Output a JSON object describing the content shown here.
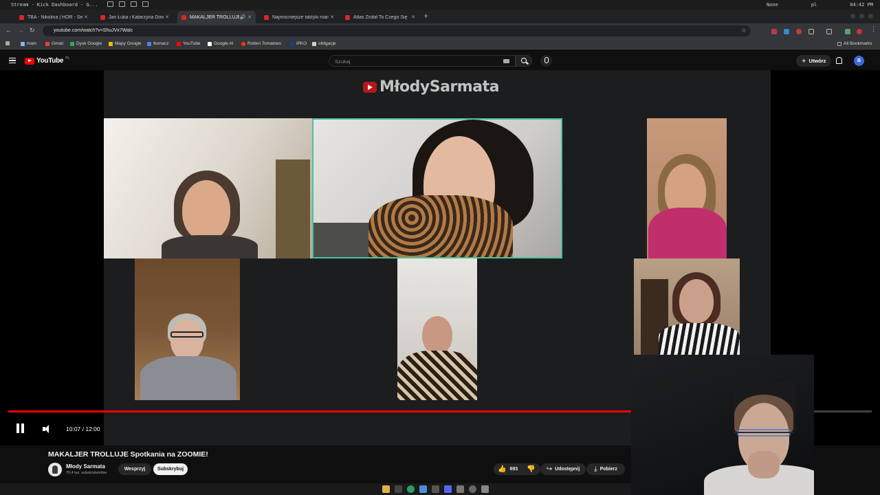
{
  "os_bar": {
    "title": "Stream - Kick Dashboard - G...",
    "status_none": "None",
    "lang": "pl",
    "clock": "04:42 PM"
  },
  "tabs": [
    {
      "label": "TBA - Nikolina | HÖR - Septe",
      "active": false
    },
    {
      "label": "Jan Łuka i Katarzyna Dowb",
      "active": false
    },
    {
      "label": "MAKALJER TROLLUJE S",
      "active": true
    },
    {
      "label": "Najmocniejsze taktyki manip",
      "active": false
    },
    {
      "label": "Atlas Zrobił To Czego Się",
      "active": false
    }
  ],
  "address": {
    "url": "youtube.com/watch?v=ShuJVx7Walc"
  },
  "bookmarks": [
    {
      "label": "main",
      "color": "#8ab4f8"
    },
    {
      "label": "Gmail",
      "color": "#ea4335"
    },
    {
      "label": "Dysk Google",
      "color": "#34a853"
    },
    {
      "label": "Mapy Google",
      "color": "#fbbc04"
    },
    {
      "label": "tłumacz",
      "color": "#4285f4"
    },
    {
      "label": "YouTube",
      "color": "#ff0000"
    },
    {
      "label": "Google AI",
      "color": "#ffffff"
    },
    {
      "label": "Rotten Tomatoes",
      "color": "#fa320a"
    },
    {
      "label": "iPKO",
      "color": "#1e3a8a"
    },
    {
      "label": "obligacje",
      "color": "#cfcfcf"
    }
  ],
  "all_bookmarks": "All Bookmarks",
  "yt": {
    "logo": "YouTube",
    "country": "PL",
    "search_placeholder": "Szukaj",
    "create_label": "Utwórz",
    "avatar_letter": "B"
  },
  "video": {
    "channel_watermark": "MłodySarmata",
    "progress": 0.8389,
    "time": "10:07 / 12:00"
  },
  "meta": {
    "title": "MAKALJER TROLLUJE Spotkania na ZOOMIE!",
    "channel": "Młody Sarmata",
    "subscribers": "70,4 tys. subskrybentów",
    "support": "Wesprzyj",
    "subscribe": "Subskrybuj",
    "likes": "693",
    "share": "Udostępnij",
    "download": "Pobierz"
  },
  "colors": {
    "accent": "#ff0000",
    "active_speaker": "#46c39b"
  }
}
